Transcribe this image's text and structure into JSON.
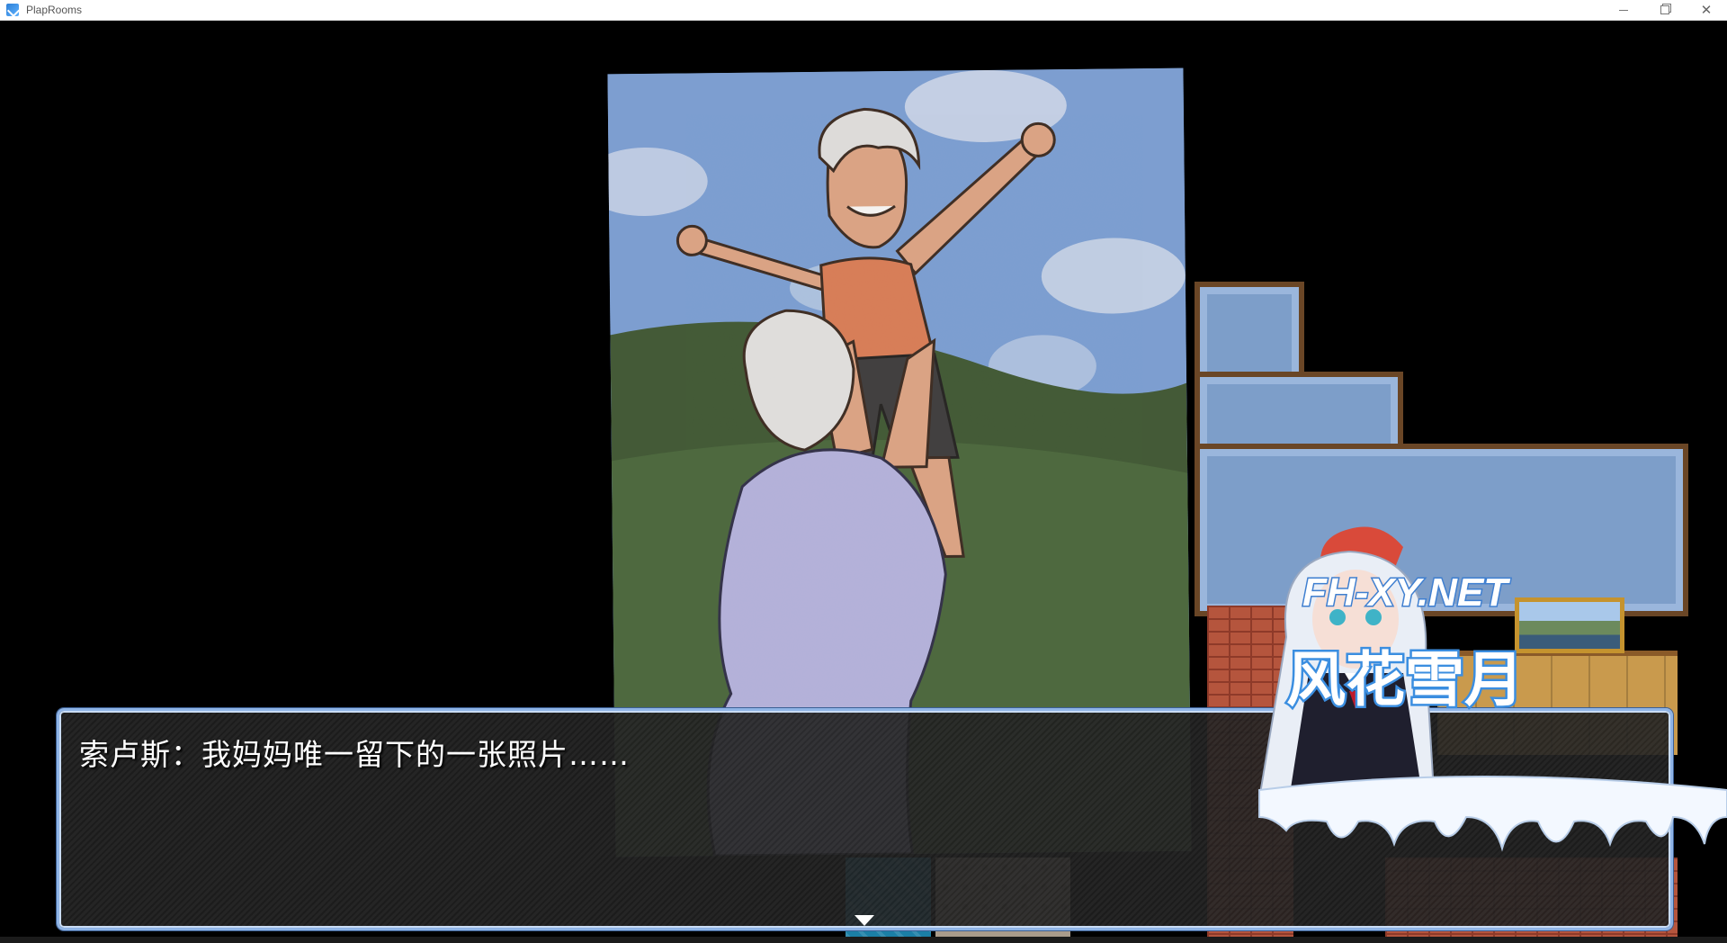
{
  "window": {
    "title": "PlapRooms",
    "icon": "app-icon",
    "controls": [
      "minimize-icon",
      "restore-icon",
      "close-icon"
    ]
  },
  "scene": {
    "type": "photo-cutscene",
    "photo_subject": "illustrated photograph"
  },
  "dialogue": {
    "text": "索卢斯：我妈妈唯一留下的一张照片……",
    "continue_indicator": "triangle-down-icon"
  },
  "watermark": {
    "domain": "FH-XY.NET",
    "brand": "风花雪月"
  },
  "colors": {
    "dialogue_border": "#8fb4e6",
    "sky": "#7da3dc",
    "grass": "#4a6a3e",
    "wall_blue": "#7d9ec9",
    "brick": "#b5553d"
  }
}
